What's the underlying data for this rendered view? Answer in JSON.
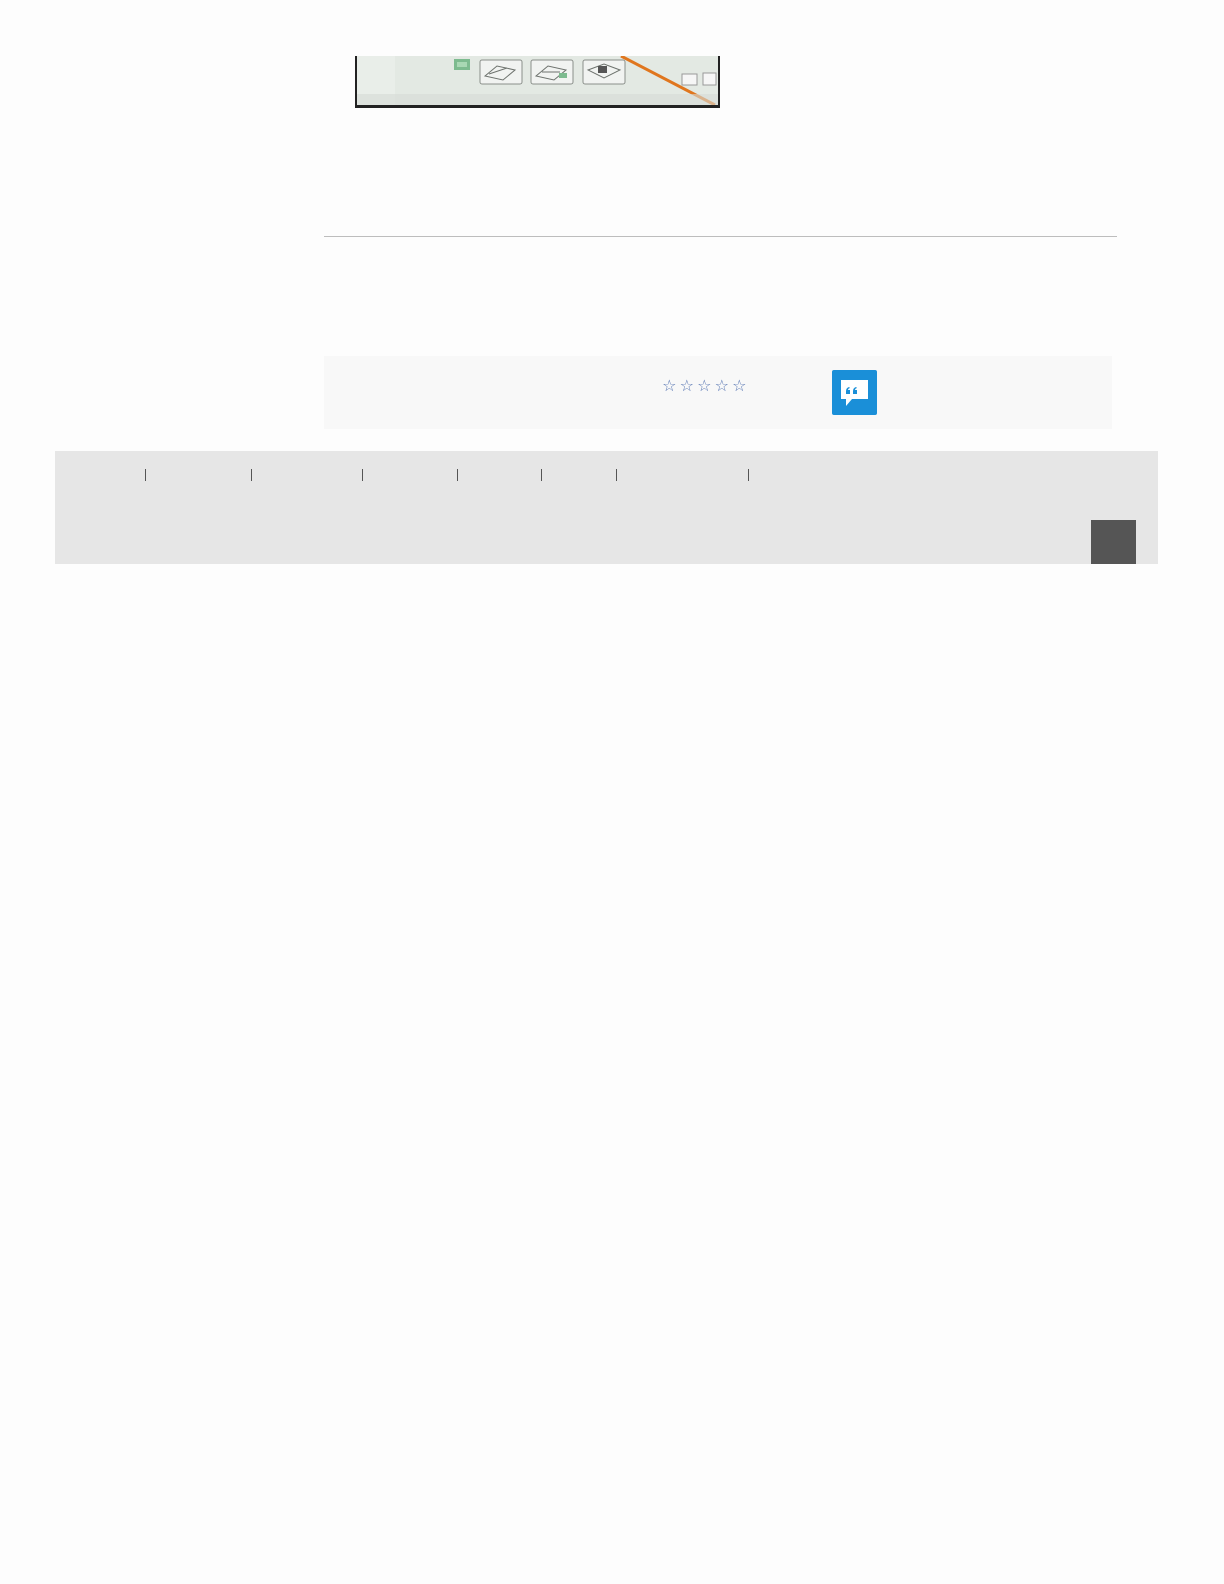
{
  "product_image": {
    "icon": "product-photo-strip"
  },
  "rating": {
    "stars": [
      "☆",
      "☆",
      "☆",
      "☆",
      "☆"
    ],
    "value": 0,
    "max": 5,
    "star_color": "#5a78b4"
  },
  "comment_button": {
    "icon": "comment-quote-icon",
    "color": "#1a8fd8"
  },
  "footer": {
    "background": "#e6e6e6",
    "nav_items": [
      "",
      "",
      "",
      "",
      "",
      "",
      "",
      ""
    ],
    "scroll_top_button": {
      "icon": "scroll-top-icon",
      "color": "#555555"
    }
  }
}
